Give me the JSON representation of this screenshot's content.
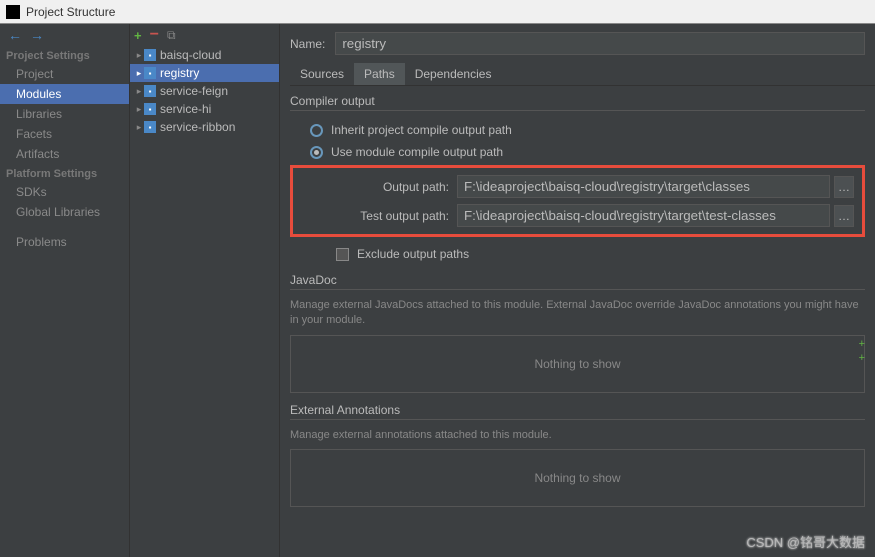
{
  "window": {
    "title": "Project Structure"
  },
  "sidebar": {
    "sections": [
      {
        "heading": "Project Settings",
        "items": [
          "Project",
          "Modules",
          "Libraries",
          "Facets",
          "Artifacts"
        ]
      },
      {
        "heading": "Platform Settings",
        "items": [
          "SDKs",
          "Global Libraries"
        ]
      },
      {
        "heading": "",
        "items": [
          "Problems"
        ]
      }
    ],
    "selected": "Modules"
  },
  "tree": {
    "items": [
      "baisq-cloud",
      "registry",
      "service-feign",
      "service-hi",
      "service-ribbon"
    ],
    "selected": "registry"
  },
  "content": {
    "name_label": "Name:",
    "name_value": "registry",
    "tabs": [
      "Sources",
      "Paths",
      "Dependencies"
    ],
    "active_tab": "Paths",
    "compiler": {
      "title": "Compiler output",
      "inherit_label": "Inherit project compile output path",
      "use_module_label": "Use module compile output path",
      "output_label": "Output path:",
      "output_value": "F:\\ideaproject\\baisq-cloud\\registry\\target\\classes",
      "test_output_label": "Test output path:",
      "test_output_value": "F:\\ideaproject\\baisq-cloud\\registry\\target\\test-classes",
      "exclude_label": "Exclude output paths"
    },
    "javadoc": {
      "title": "JavaDoc",
      "desc": "Manage external JavaDocs attached to this module. External JavaDoc override JavaDoc annotations you might have in your module.",
      "empty": "Nothing to show"
    },
    "annotations": {
      "title": "External Annotations",
      "desc": "Manage external annotations attached to this module.",
      "empty": "Nothing to show"
    }
  },
  "watermark": "CSDN @铭哥大数据"
}
